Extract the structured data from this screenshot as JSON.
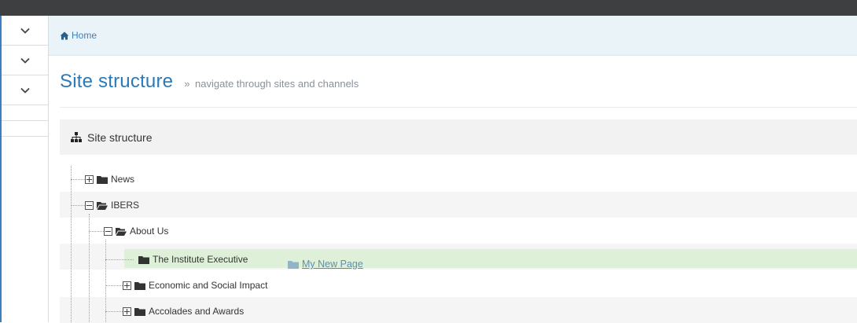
{
  "breadcrumb": {
    "home_label": "Home",
    "home_icon": "home-icon"
  },
  "page": {
    "title": "Site structure",
    "subtitle_marker": "»",
    "subtitle": "navigate through sites and channels"
  },
  "panel": {
    "title": "Site structure",
    "icon": "sitemap-icon"
  },
  "sidebar": {
    "toggles": [
      "chevron-down-icon",
      "chevron-down-icon",
      "chevron-down-icon"
    ]
  },
  "tree": {
    "nodes": [
      {
        "label": "News",
        "toggle": "plus",
        "folder": "closed"
      },
      {
        "label": "IBERS",
        "toggle": "minus",
        "folder": "open"
      },
      {
        "label": "About Us",
        "toggle": "minus",
        "folder": "open"
      },
      {
        "label": "The Institute Executive",
        "toggle": "none",
        "folder": "closed"
      },
      {
        "label": "Economic and Social Impact",
        "toggle": "plus",
        "folder": "closed"
      },
      {
        "label": "Accolades and Awards",
        "toggle": "plus",
        "folder": "closed"
      }
    ],
    "drag_item": {
      "label": "My New Page",
      "folder": "closed"
    }
  },
  "colors": {
    "accent": "#2a79b9",
    "topbar": "#3e3f40",
    "highlight_row": "#dff0d8",
    "breadcrumb_bg": "#eaf3f8"
  }
}
